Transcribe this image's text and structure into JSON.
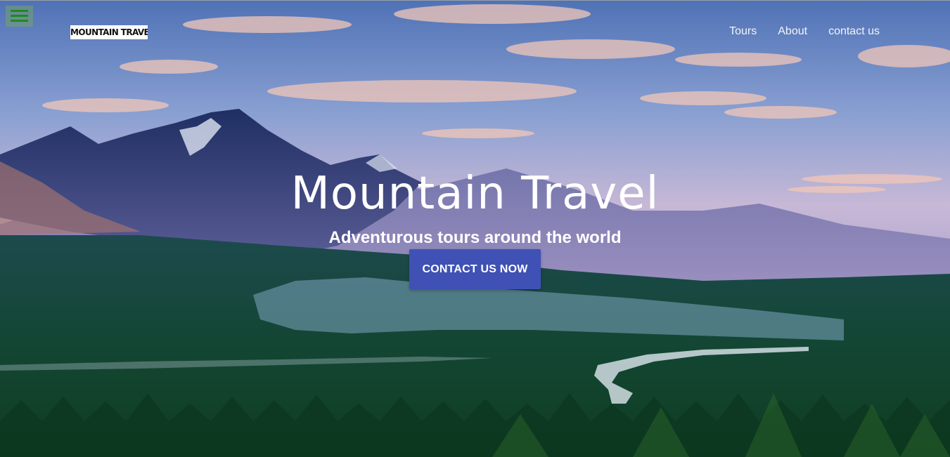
{
  "menu_toggle": {
    "icon": "hamburger-menu-icon",
    "color": "#1e8a1e"
  },
  "logo": {
    "text": "MOUNTAIN TRAVEL"
  },
  "nav": {
    "items": [
      {
        "label": "Tours"
      },
      {
        "label": "About"
      },
      {
        "label": "contact us"
      }
    ]
  },
  "hero": {
    "title": "Mountain Travel",
    "subtitle": "Adventurous tours around the world",
    "cta_label": "CONTACT US NOW",
    "cta_color": "#3f51b5",
    "background": "mountain-landscape-photo"
  }
}
